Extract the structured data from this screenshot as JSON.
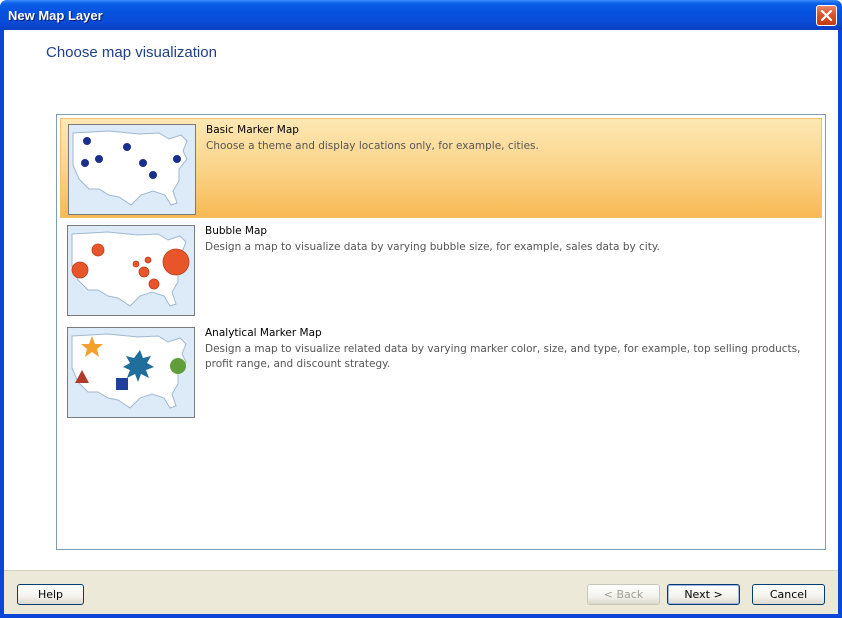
{
  "window": {
    "title": "New Map Layer"
  },
  "heading": "Choose map visualization",
  "options": [
    {
      "title": "Basic Marker Map",
      "description": "Choose a theme and display locations only, for example, cities.",
      "selected": true
    },
    {
      "title": "Bubble Map",
      "description": "Design a map to visualize data by varying bubble size, for example, sales data by city.",
      "selected": false
    },
    {
      "title": "Analytical Marker Map",
      "description": "Design a map to visualize related data by varying marker color, size, and type, for example, top selling products, profit range, and discount strategy.",
      "selected": false
    }
  ],
  "buttons": {
    "help": "Help",
    "back": "< Back",
    "next": "Next >",
    "cancel": "Cancel"
  },
  "colors": {
    "selection": "#f8b954",
    "map_land": "#ffffff",
    "map_water": "#dcebf7",
    "marker_dot": "#1a2f8c",
    "bubble": "#e8552a",
    "star_orange": "#f4a12c",
    "starburst_blue": "#1f6e9c",
    "triangle_red": "#b23a2a",
    "square_blue": "#1f3f9c",
    "circle_green": "#5f9e3a"
  }
}
